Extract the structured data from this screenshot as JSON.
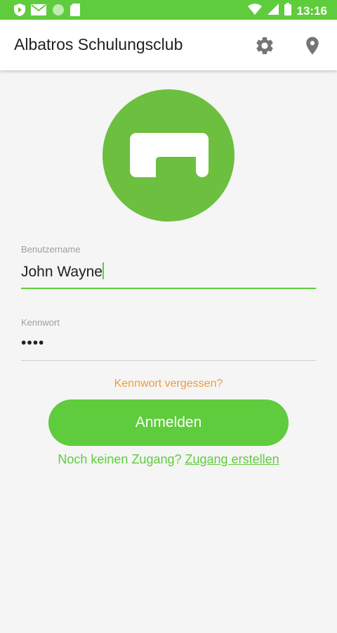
{
  "status_bar": {
    "time": "13:16",
    "color": "#5ecc3c",
    "left_icons": [
      "shield-play-icon",
      "mail-icon",
      "circle-icon",
      "sd-card-icon"
    ],
    "right_icons": [
      "wifi-icon",
      "signal-icon",
      "battery-icon"
    ]
  },
  "app_bar": {
    "title": "Albatros Schulungsclub",
    "actions": [
      "gear-icon",
      "location-pin-icon"
    ]
  },
  "logo": {
    "icon": "albatros-logo-icon",
    "color": "#6cbf3f"
  },
  "login_form": {
    "username_label": "Benutzername",
    "username_value": "John Wayne",
    "password_label": "Kennwort",
    "password_value": "••••",
    "forgot_password": "Kennwort vergessen?",
    "submit_label": "Anmelden",
    "register_prompt": "Noch keinen Zugang?",
    "register_link": "Zugang erstellen"
  },
  "colors": {
    "primary": "#5ecc3c",
    "accent": "#f39a3a",
    "background": "#f5f5f5"
  }
}
